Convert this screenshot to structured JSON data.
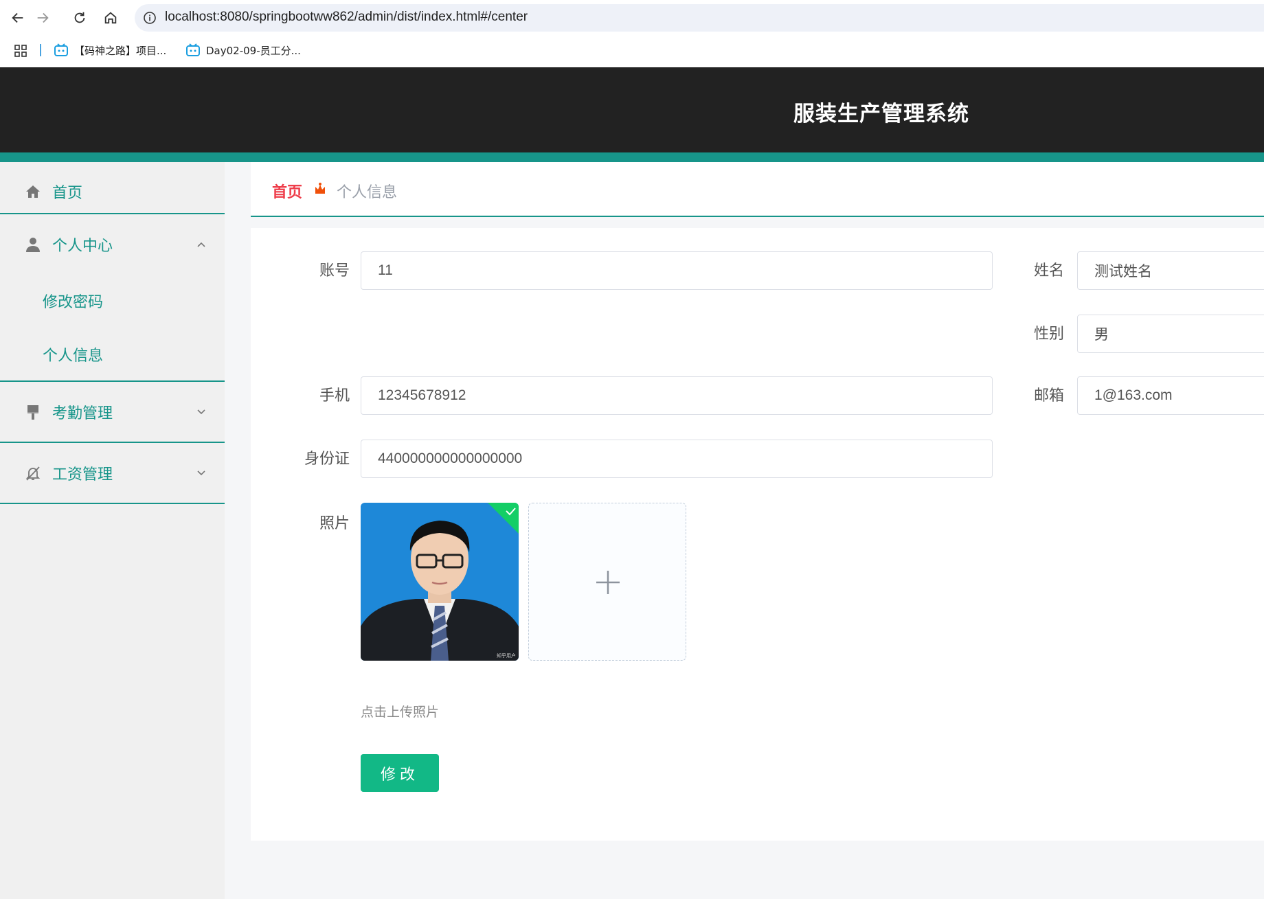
{
  "browser": {
    "url": "localhost:8080/springbootww862/admin/dist/index.html#/center",
    "bookmarks": [
      {
        "label": "【码神之路】项目..."
      },
      {
        "label": "Day02-09-员工分..."
      }
    ]
  },
  "app": {
    "title": "服装生产管理系统",
    "accent_color": "#17958a",
    "header_bg": "#222222"
  },
  "sidebar": {
    "items": [
      {
        "label": "首页",
        "icon": "home-icon"
      },
      {
        "label": "个人中心",
        "icon": "user-icon",
        "expanded": true,
        "children": [
          {
            "label": "修改密码"
          },
          {
            "label": "个人信息"
          }
        ]
      },
      {
        "label": "考勤管理",
        "icon": "brush-icon",
        "expanded": false
      },
      {
        "label": "工资管理",
        "icon": "bell-off-icon",
        "expanded": false
      }
    ]
  },
  "breadcrumb": {
    "home": "首页",
    "current": "个人信息"
  },
  "form": {
    "account": {
      "label": "账号",
      "value": "11"
    },
    "name": {
      "label": "姓名",
      "value": "测试姓名"
    },
    "gender": {
      "label": "性别",
      "value": "男"
    },
    "phone": {
      "label": "手机",
      "value": "12345678912"
    },
    "email": {
      "label": "邮箱",
      "value": "1@163.com"
    },
    "id_card": {
      "label": "身份证",
      "value": "440000000000000000"
    },
    "photo": {
      "label": "照片",
      "hint": "点击上传照片",
      "watermark": "知乎用户"
    },
    "submit_label": "修改"
  }
}
